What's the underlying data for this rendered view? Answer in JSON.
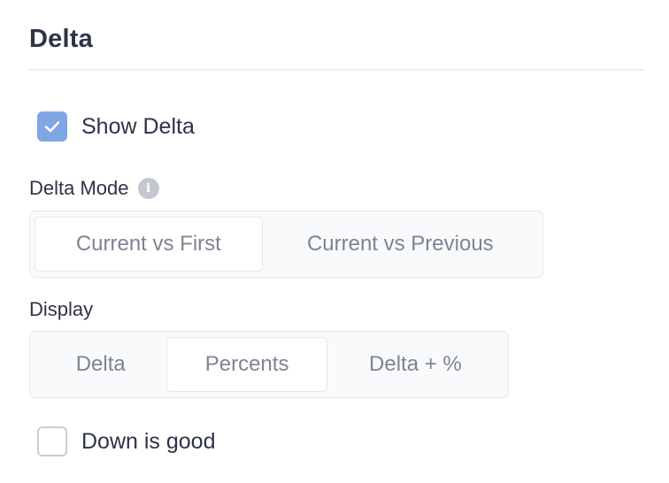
{
  "section": {
    "title": "Delta"
  },
  "show_delta": {
    "label": "Show Delta",
    "checked": true
  },
  "delta_mode": {
    "label": "Delta Mode",
    "info_icon": "info-icon",
    "options": [
      "Current vs First",
      "Current vs Previous"
    ],
    "selected": "Current vs First"
  },
  "display": {
    "label": "Display",
    "options": [
      "Delta",
      "Percents",
      "Delta + %"
    ],
    "selected": "Percents"
  },
  "down_is_good": {
    "label": "Down is good",
    "checked": false
  },
  "colors": {
    "accent": "#7fa7e4",
    "text": "#2e3347",
    "muted_text": "#7e8493",
    "border": "#e4e7eb"
  }
}
